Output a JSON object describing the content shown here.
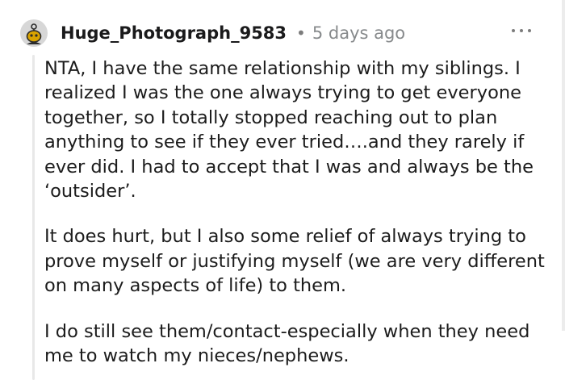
{
  "comment": {
    "username": "Huge_Photograph_9583",
    "separator": "•",
    "time_ago": "5 days ago",
    "more_icon": "more-horizontal-icon",
    "avatar_icon": "user-avatar-icon",
    "paragraphs": [
      "NTA, I have the same relationship with my siblings. I realized I was the one always trying to get everyone together, so I totally stopped reaching out to plan anything to see if they ever tried….and they rarely if ever did. I had to accept that I was and always be the ‘outsider’.",
      "It does hurt, but I also some relief of always trying to prove myself or justifying myself (we are very different on many aspects of life) to them.",
      "I do still see them/contact-especially when they need me to watch my nieces/nephews."
    ]
  },
  "colors": {
    "avatar_bg": "#d7d7d7",
    "avatar_face": "#d9a300",
    "text": "#1c1c1c",
    "meta": "#878a8c"
  }
}
